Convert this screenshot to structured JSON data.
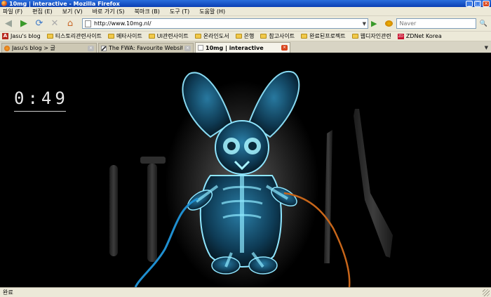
{
  "window": {
    "title": "10mg | interactive - Mozilla Firefox",
    "minimize_glyph": "_",
    "maximize_glyph": "□",
    "close_glyph": "×"
  },
  "menu": {
    "items": [
      {
        "label": "파일 (F)"
      },
      {
        "label": "편집 (E)"
      },
      {
        "label": "보기 (V)"
      },
      {
        "label": "바로 가기 (S)"
      },
      {
        "label": "북마크 (B)"
      },
      {
        "label": "도구 (T)"
      },
      {
        "label": "도움말 (H)"
      }
    ]
  },
  "nav": {
    "back_glyph": "◀",
    "forward_glyph": "▶",
    "reload_glyph": "⟳",
    "stop_glyph": "✕",
    "home_glyph": "⌂",
    "url": "http://www.10mg.nl/",
    "dropdown_glyph": "▼",
    "go_glyph": "▶",
    "search_placeholder": "Naver",
    "search_go_glyph": "🔍"
  },
  "bookmarks": {
    "items": [
      {
        "label": "Jasu's blog",
        "icon": "a-favicon-icon"
      },
      {
        "label": "티스토리관련사이트",
        "icon": "folder-icon"
      },
      {
        "label": "메타사이트",
        "icon": "folder-icon"
      },
      {
        "label": "UI관련사이트",
        "icon": "folder-icon"
      },
      {
        "label": "온라인도서",
        "icon": "folder-icon"
      },
      {
        "label": "은행",
        "icon": "folder-icon"
      },
      {
        "label": "참고사이트",
        "icon": "folder-icon"
      },
      {
        "label": "완료된프로젝트",
        "icon": "folder-icon"
      },
      {
        "label": "웹디자인관련",
        "icon": "folder-icon"
      },
      {
        "label": "ZDNet Korea",
        "icon": "zdnet-favicon-icon"
      }
    ],
    "zdnet_mark": "ZD",
    "a_mark": "A"
  },
  "tabs": {
    "items": [
      {
        "label": "Jasu's blog > 글",
        "active": false
      },
      {
        "label": "The FWA: Favourite Website Aw...",
        "active": false
      },
      {
        "label": "10mg | interactive",
        "active": true
      }
    ],
    "close_glyph": "×",
    "scroll_glyph": "▼"
  },
  "content": {
    "timer": "0:49",
    "background": "#000000",
    "glow_color": "#5fd8ff",
    "wire_blue": "#1f8fd0",
    "wire_orange": "#c8661a"
  },
  "status": {
    "text": "완료"
  }
}
